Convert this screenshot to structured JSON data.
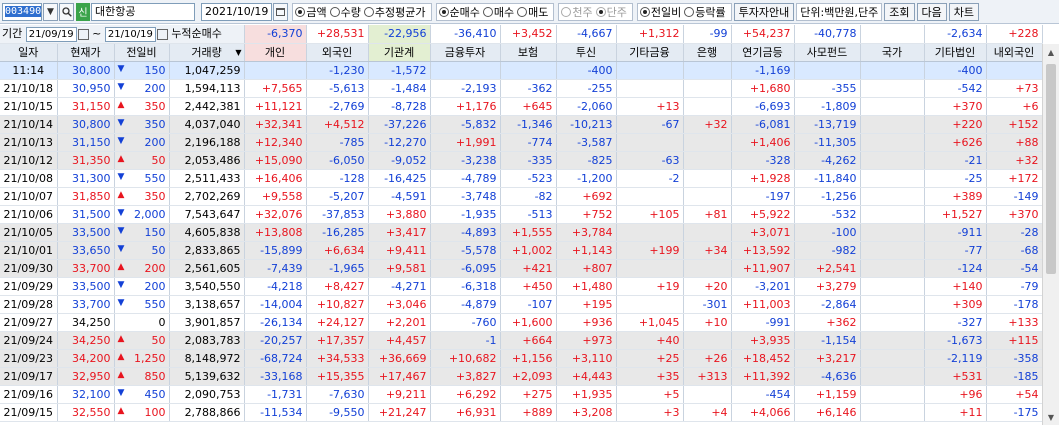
{
  "toolbar": {
    "code": "003490",
    "search_icon": "search-icon",
    "badge": "신",
    "stock_name": "대한항공",
    "date": "2021/10/19",
    "amount_group": [
      {
        "label": "금액",
        "checked": true
      },
      {
        "label": "수량",
        "checked": false
      },
      {
        "label": "추정평균가",
        "checked": false
      }
    ],
    "trade_group": [
      {
        "label": "순매수",
        "checked": true
      },
      {
        "label": "매수",
        "checked": false
      },
      {
        "label": "매도",
        "checked": false
      }
    ],
    "unit_group": [
      {
        "label": "천주",
        "checked": false,
        "disabled": true
      },
      {
        "label": "단주",
        "checked": true,
        "disabled": true
      }
    ],
    "compare_group": [
      {
        "label": "전일비",
        "checked": true
      },
      {
        "label": "등락률",
        "checked": false
      }
    ],
    "investor_guide": "투자자안내",
    "unit_label": "단위:백만원,단주",
    "query_button": "조회",
    "next_button": "다음",
    "chart_button": "차트"
  },
  "period": {
    "label": "기간",
    "from": "21/09/19",
    "sep": "~",
    "to": "21/10/19",
    "caption": "누적순매수",
    "values": [
      "-6,370",
      "+28,531",
      "-22,956",
      "-36,410",
      "+3,452",
      "-4,667",
      "+1,312",
      "-99",
      "+54,237",
      "-40,778",
      "",
      "-2,634",
      "+228"
    ]
  },
  "columns": [
    "일자",
    "현재가",
    "전일비",
    "거래량",
    "개인",
    "외국인",
    "기관계",
    "금융투자",
    "보험",
    "투신",
    "기타금융",
    "은행",
    "연기금등",
    "사모펀드",
    "국가",
    "기타법인",
    "내외국인"
  ],
  "rows": [
    {
      "date": "11:14",
      "price": "30,800",
      "dir": "down",
      "change": "150",
      "volume": "1,047,259",
      "vals": [
        "",
        "-1,230",
        "-1,572",
        "",
        "",
        "-400",
        "",
        "",
        "-1,169",
        "",
        "",
        "-400",
        ""
      ]
    },
    {
      "date": "21/10/18",
      "price": "30,950",
      "dir": "down",
      "change": "200",
      "volume": "1,594,113",
      "vals": [
        "+7,565",
        "-5,613",
        "-1,484",
        "-2,193",
        "-362",
        "-255",
        "",
        "",
        "+1,680",
        "-355",
        "",
        "-542",
        "+73"
      ]
    },
    {
      "date": "21/10/15",
      "price": "31,150",
      "dir": "up",
      "change": "350",
      "volume": "2,442,381",
      "vals": [
        "+11,121",
        "-2,769",
        "-8,728",
        "+1,176",
        "+645",
        "-2,060",
        "+13",
        "",
        "-6,693",
        "-1,809",
        "",
        "+370",
        "+6"
      ]
    },
    {
      "date": "21/10/14",
      "price": "30,800",
      "dir": "down",
      "change": "350",
      "volume": "4,037,040",
      "vals": [
        "+32,341",
        "+4,512",
        "-37,226",
        "-5,832",
        "-1,346",
        "-10,213",
        "-67",
        "+32",
        "-6,081",
        "-13,719",
        "",
        "+220",
        "+152"
      ]
    },
    {
      "date": "21/10/13",
      "price": "31,150",
      "dir": "down",
      "change": "200",
      "volume": "2,196,188",
      "vals": [
        "+12,340",
        "-785",
        "-12,270",
        "+1,991",
        "-774",
        "-3,587",
        "",
        "",
        "+1,406",
        "-11,305",
        "",
        "+626",
        "+88"
      ]
    },
    {
      "date": "21/10/12",
      "price": "31,350",
      "dir": "up",
      "change": "50",
      "volume": "2,053,486",
      "vals": [
        "+15,090",
        "-6,050",
        "-9,052",
        "-3,238",
        "-335",
        "-825",
        "-63",
        "",
        "-328",
        "-4,262",
        "",
        "-21",
        "+32"
      ]
    },
    {
      "date": "21/10/08",
      "price": "31,300",
      "dir": "down",
      "change": "550",
      "volume": "2,511,433",
      "vals": [
        "+16,406",
        "-128",
        "-16,425",
        "-4,789",
        "-523",
        "-1,200",
        "-2",
        "",
        "+1,928",
        "-11,840",
        "",
        "-25",
        "+172"
      ]
    },
    {
      "date": "21/10/07",
      "price": "31,850",
      "dir": "up",
      "change": "350",
      "volume": "2,702,269",
      "vals": [
        "+9,558",
        "-5,207",
        "-4,591",
        "-3,748",
        "-82",
        "+692",
        "",
        "",
        "-197",
        "-1,256",
        "",
        "+389",
        "-149"
      ]
    },
    {
      "date": "21/10/06",
      "price": "31,500",
      "dir": "down",
      "change": "2,000",
      "volume": "7,543,647",
      "vals": [
        "+32,076",
        "-37,853",
        "+3,880",
        "-1,935",
        "-513",
        "+752",
        "+105",
        "+81",
        "+5,922",
        "-532",
        "",
        "+1,527",
        "+370"
      ]
    },
    {
      "date": "21/10/05",
      "price": "33,500",
      "dir": "down",
      "change": "150",
      "volume": "4,605,838",
      "vals": [
        "+13,808",
        "-16,285",
        "+3,417",
        "-4,893",
        "+1,555",
        "+3,784",
        "",
        "",
        "+3,071",
        "-100",
        "",
        "-911",
        "-28"
      ]
    },
    {
      "date": "21/10/01",
      "price": "33,650",
      "dir": "down",
      "change": "50",
      "volume": "2,833,865",
      "vals": [
        "-15,899",
        "+6,634",
        "+9,411",
        "-5,578",
        "+1,002",
        "+1,143",
        "+199",
        "+34",
        "+13,592",
        "-982",
        "",
        "-77",
        "-68"
      ]
    },
    {
      "date": "21/09/30",
      "price": "33,700",
      "dir": "up",
      "change": "200",
      "volume": "2,561,605",
      "vals": [
        "-7,439",
        "-1,965",
        "+9,581",
        "-6,095",
        "+421",
        "+807",
        "",
        "",
        "+11,907",
        "+2,541",
        "",
        "-124",
        "-54"
      ]
    },
    {
      "date": "21/09/29",
      "price": "33,500",
      "dir": "down",
      "change": "200",
      "volume": "3,540,550",
      "vals": [
        "-4,218",
        "+8,427",
        "-4,271",
        "-6,318",
        "+450",
        "+1,480",
        "+19",
        "+20",
        "-3,201",
        "+3,279",
        "",
        "+140",
        "-79"
      ]
    },
    {
      "date": "21/09/28",
      "price": "33,700",
      "dir": "down",
      "change": "550",
      "volume": "3,138,657",
      "vals": [
        "-14,004",
        "+10,827",
        "+3,046",
        "-4,879",
        "-107",
        "+195",
        "",
        "-301",
        "+11,003",
        "-2,864",
        "",
        "+309",
        "-178"
      ]
    },
    {
      "date": "21/09/27",
      "price": "34,250",
      "dir": "none",
      "change": "0",
      "volume": "3,901,857",
      "vals": [
        "-26,134",
        "+24,127",
        "+2,201",
        "-760",
        "+1,600",
        "+936",
        "+1,045",
        "+10",
        "-991",
        "+362",
        "",
        "-327",
        "+133"
      ]
    },
    {
      "date": "21/09/24",
      "price": "34,250",
      "dir": "up",
      "change": "50",
      "volume": "2,083,783",
      "vals": [
        "-20,257",
        "+17,357",
        "+4,457",
        "-1",
        "+664",
        "+973",
        "+40",
        "",
        "+3,935",
        "-1,154",
        "",
        "-1,673",
        "+115"
      ]
    },
    {
      "date": "21/09/23",
      "price": "34,200",
      "dir": "up",
      "change": "1,250",
      "volume": "8,148,972",
      "vals": [
        "-68,724",
        "+34,533",
        "+36,669",
        "+10,682",
        "+1,156",
        "+3,110",
        "+25",
        "+26",
        "+18,452",
        "+3,217",
        "",
        "-2,119",
        "-358"
      ]
    },
    {
      "date": "21/09/17",
      "price": "32,950",
      "dir": "up",
      "change": "850",
      "volume": "5,139,632",
      "vals": [
        "-33,168",
        "+15,355",
        "+17,467",
        "+3,827",
        "+2,093",
        "+4,443",
        "+35",
        "+313",
        "+11,392",
        "-4,636",
        "",
        "+531",
        "-185"
      ]
    },
    {
      "date": "21/09/16",
      "price": "32,100",
      "dir": "down",
      "change": "450",
      "volume": "2,090,753",
      "vals": [
        "-1,731",
        "-7,630",
        "+9,211",
        "+6,292",
        "+275",
        "+1,935",
        "+5",
        "",
        "-454",
        "+1,159",
        "",
        "+96",
        "+54"
      ]
    },
    {
      "date": "21/09/15",
      "price": "32,550",
      "dir": "up",
      "change": "100",
      "volume": "2,788,866",
      "vals": [
        "-11,534",
        "-9,550",
        "+21,247",
        "+6,931",
        "+889",
        "+3,208",
        "+3",
        "+4",
        "+4,066",
        "+6,146",
        "",
        "+11",
        "-175"
      ]
    }
  ],
  "gray_rows": [
    3,
    4,
    5,
    9,
    10,
    11,
    15,
    16,
    17
  ],
  "colors": {
    "up": "#e8141e",
    "down": "#1340d6",
    "current_row": "#d9e9ff",
    "alt_row": "#e8e8e8"
  }
}
